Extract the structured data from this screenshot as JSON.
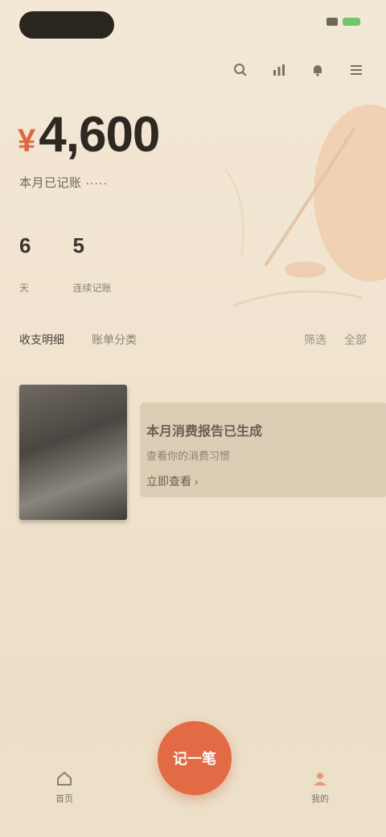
{
  "status_bar": {
    "battery_color": "#74c46e"
  },
  "header": {
    "tools": [
      {
        "icon": "search-icon"
      },
      {
        "icon": "chart-icon"
      },
      {
        "icon": "bell-icon"
      },
      {
        "icon": "menu-icon"
      }
    ]
  },
  "balance": {
    "currency": "¥",
    "amount": "4,600",
    "subtitle": "本月已记账 ·····"
  },
  "stats": [
    {
      "value": "6",
      "label": "天"
    },
    {
      "value": "5",
      "label": "连续记账"
    }
  ],
  "tabs": {
    "left": [
      "收支明细",
      "账单分类"
    ],
    "right": [
      "筛选",
      "全部"
    ]
  },
  "card": {
    "title": "本月消费报告已生成",
    "subtitle": "查看你的消费习惯",
    "link": "立即查看 ›"
  },
  "bottom_nav": {
    "home_label": "首页",
    "fab_label": "记一笔",
    "me_label": "我的"
  },
  "colors": {
    "accent": "#e26a45",
    "background": "#f2e6d3",
    "text": "#2e2823"
  }
}
